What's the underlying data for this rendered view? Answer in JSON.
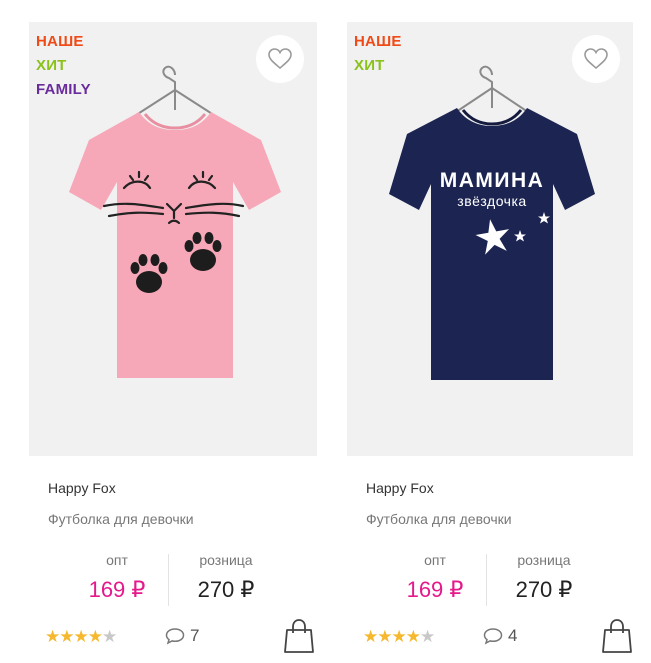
{
  "products": [
    {
      "badges": [
        {
          "text": "НАШЕ",
          "color": "#f04a17"
        },
        {
          "text": "ХИТ",
          "color": "#8bc21a"
        },
        {
          "text": "FAMILY",
          "color": "#6a2b9c"
        }
      ],
      "brand": "Happy Fox",
      "title": "Футболка для девочки",
      "wholesale_label": "опт",
      "wholesale_price": "169 ₽",
      "retail_label": "розница",
      "retail_price": "270 ₽",
      "rating": 4,
      "rating_max": 5,
      "comments": "7",
      "shirt_color": "#f7a8b8"
    },
    {
      "badges": [
        {
          "text": "НАШЕ",
          "color": "#f04a17"
        },
        {
          "text": "ХИТ",
          "color": "#8bc21a"
        }
      ],
      "brand": "Happy Fox",
      "title": "Футболка для девочки",
      "wholesale_label": "опт",
      "wholesale_price": "169 ₽",
      "retail_label": "розница",
      "retail_price": "270 ₽",
      "rating": 4,
      "rating_max": 5,
      "comments": "4",
      "shirt_color": "#1c2552",
      "print_line1": "МАМИНА",
      "print_line2": "звёздочка"
    }
  ],
  "colors": {
    "price_accent": "#e5198b",
    "star_active": "#f5b82e",
    "star_inactive": "#c8c8c8"
  },
  "icons": [
    "heart-icon",
    "hanger-icon",
    "comment-icon",
    "shopping-bag-icon",
    "star-icon"
  ]
}
